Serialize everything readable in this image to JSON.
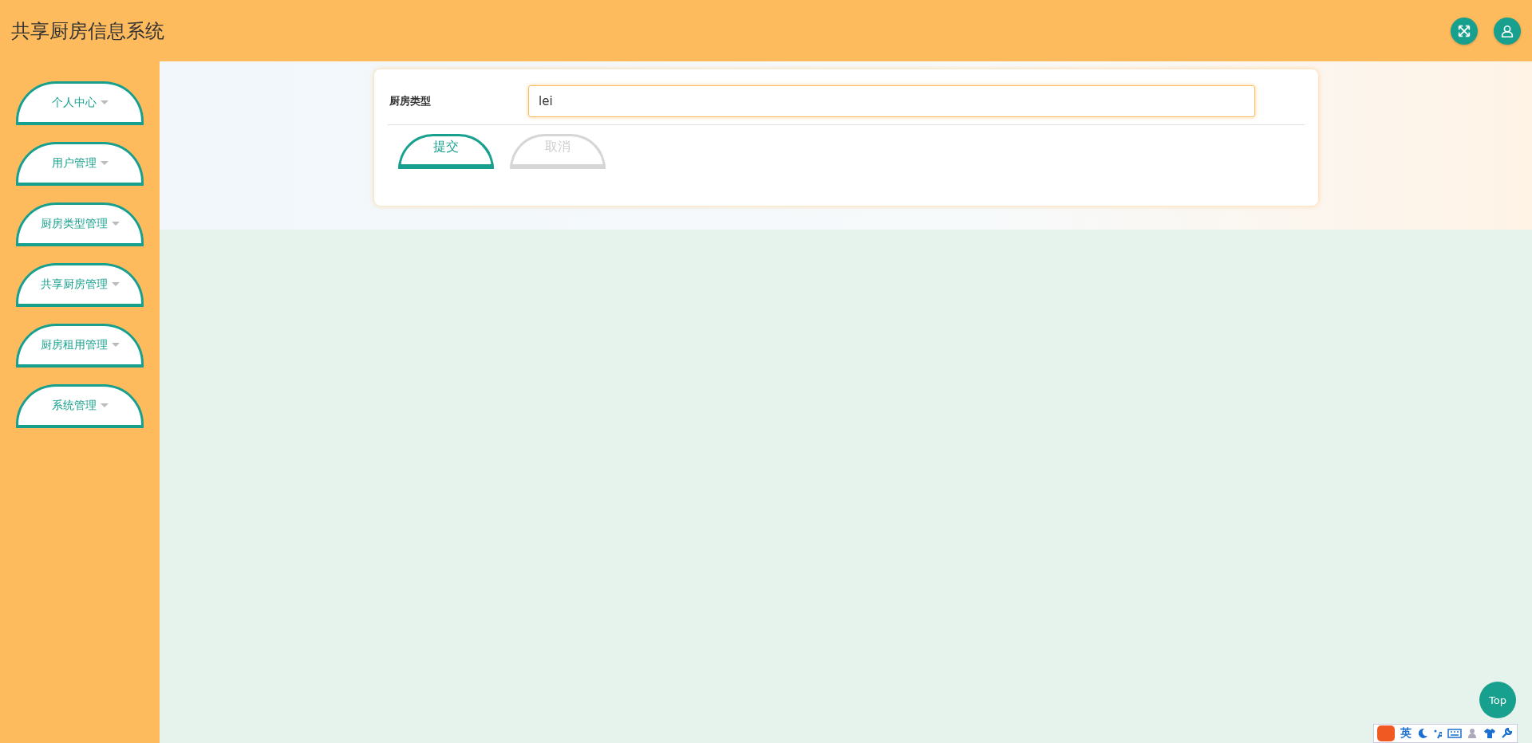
{
  "header": {
    "title": "共享厨房信息系统"
  },
  "sidebar": {
    "items": [
      {
        "label": "个人中心"
      },
      {
        "label": "用户管理"
      },
      {
        "label": "厨房类型管理"
      },
      {
        "label": "共享厨房管理"
      },
      {
        "label": "厨房租用管理"
      },
      {
        "label": "系统管理"
      }
    ]
  },
  "form": {
    "fields": [
      {
        "label": "厨房类型",
        "value": "lei"
      }
    ],
    "buttons": [
      {
        "label": "提交",
        "kind": "primary"
      },
      {
        "label": "取消",
        "kind": "secondary"
      }
    ]
  },
  "back_to_top": {
    "label": "Top"
  },
  "ime_toolbar": {
    "mode": "英"
  }
}
